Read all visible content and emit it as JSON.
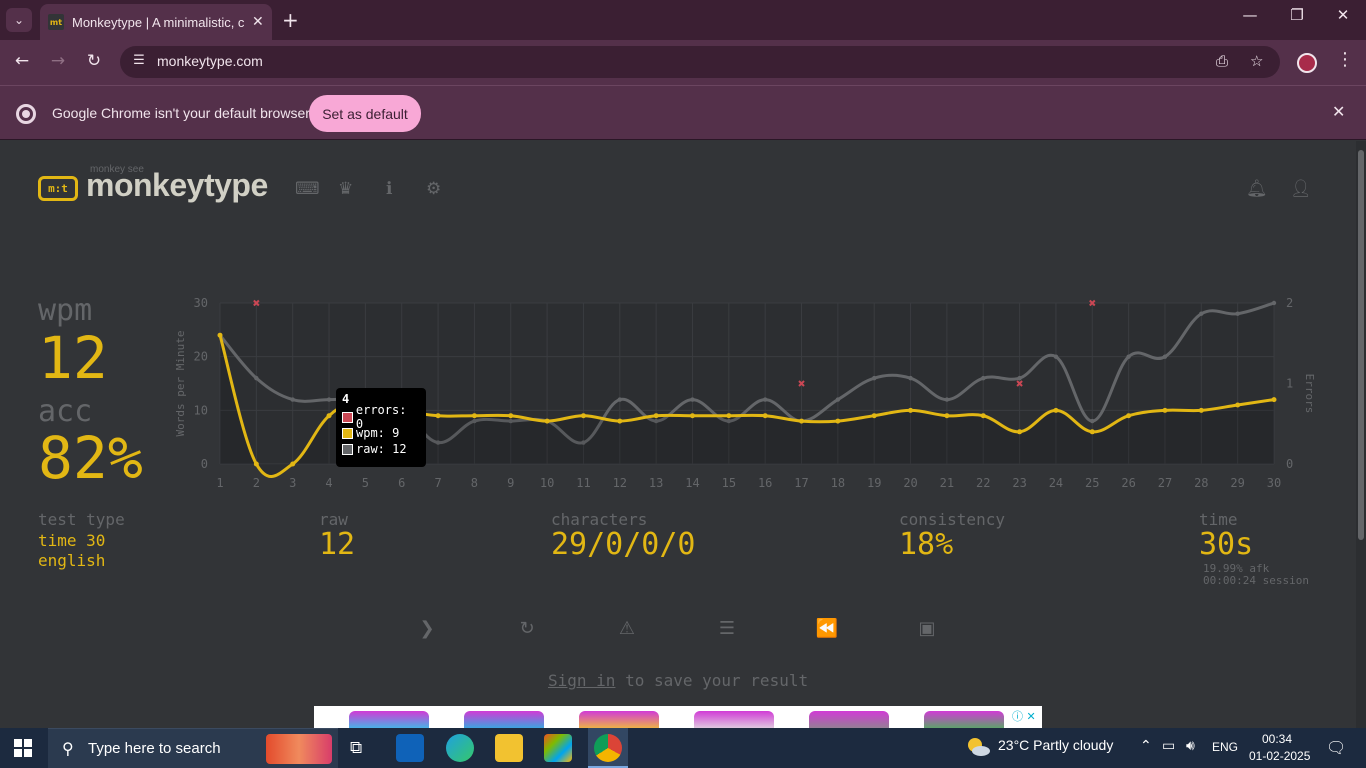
{
  "browser": {
    "tab_title": "Monkeytype | A minimalistic, cu",
    "favicon_text": "mt",
    "url": "monkeytype.com",
    "infobar_text": "Google Chrome isn't your default browser",
    "infobar_button": "Set as default",
    "accent_color": "#f8a8d6"
  },
  "site": {
    "logo_icon_text": "m:t",
    "logo_small": "monkey see",
    "logo_text": "monkeytype",
    "header_icons": [
      "keyboard-icon",
      "crown-icon",
      "info-icon",
      "gear-icon",
      "bell-icon",
      "user-icon"
    ]
  },
  "results": {
    "wpm_label": "wpm",
    "wpm_value": "12",
    "acc_label": "acc",
    "acc_value": "82%",
    "test_type_label": "test type",
    "test_type_line1": "time 30",
    "test_type_line2": "english",
    "raw_label": "raw",
    "raw_value": "12",
    "characters_label": "characters",
    "characters_value": "29/0/0/0",
    "consistency_label": "consistency",
    "consistency_value": "18%",
    "time_label": "time",
    "time_value": "30s",
    "afk": "19.99% afk",
    "session": "00:00:24 session"
  },
  "tooltip": {
    "title": "4",
    "errors": "errors: 0",
    "wpm": "wpm: 9",
    "raw": "raw: 12"
  },
  "actions": [
    "next-test-icon",
    "restart-icon",
    "report-icon",
    "words-history-icon",
    "replay-icon",
    "screenshot-icon"
  ],
  "signin": {
    "link": "Sign in",
    "text": " to save your result"
  },
  "colors": {
    "bg": "#323437",
    "main": "#e2b714",
    "sub": "#646669",
    "text": "#d1d0c5",
    "error": "#ca4754"
  },
  "chart_data": {
    "type": "line",
    "title": "",
    "xlabel": "",
    "ylabel": "Words per Minute",
    "y2label": "Errors",
    "x": [
      1,
      2,
      3,
      4,
      5,
      6,
      7,
      8,
      9,
      10,
      11,
      12,
      13,
      14,
      15,
      16,
      17,
      18,
      19,
      20,
      21,
      22,
      23,
      24,
      25,
      26,
      27,
      28,
      29,
      30
    ],
    "ylim": [
      0,
      30
    ],
    "y2lim": [
      0,
      2
    ],
    "yticks": [
      0,
      10,
      20,
      30
    ],
    "y2ticks": [
      0,
      1,
      2
    ],
    "series": [
      {
        "key": "wpm",
        "values": [
          24,
          0,
          0,
          9,
          12,
          10,
          9,
          9,
          9,
          8,
          9,
          8,
          9,
          9,
          9,
          9,
          8,
          8,
          9,
          10,
          9,
          9,
          6,
          10,
          6,
          9,
          10,
          10,
          11,
          12
        ]
      },
      {
        "key": "raw",
        "values": [
          24,
          16,
          12,
          12,
          12,
          10,
          4,
          8,
          8,
          8,
          4,
          12,
          8,
          12,
          8,
          12,
          8,
          12,
          16,
          16,
          12,
          16,
          16,
          20,
          8,
          20,
          20,
          28,
          28,
          30
        ]
      },
      {
        "key": "errors",
        "axis": "right",
        "x": [
          2,
          17,
          23,
          25
        ],
        "values": [
          2,
          1,
          1,
          2
        ]
      }
    ],
    "grid": true
  },
  "taskbar": {
    "search_placeholder": "Type here to search",
    "weather": "23°C  Partly cloudy",
    "lang": "ENG",
    "time": "00:34",
    "date": "01-02-2025"
  }
}
